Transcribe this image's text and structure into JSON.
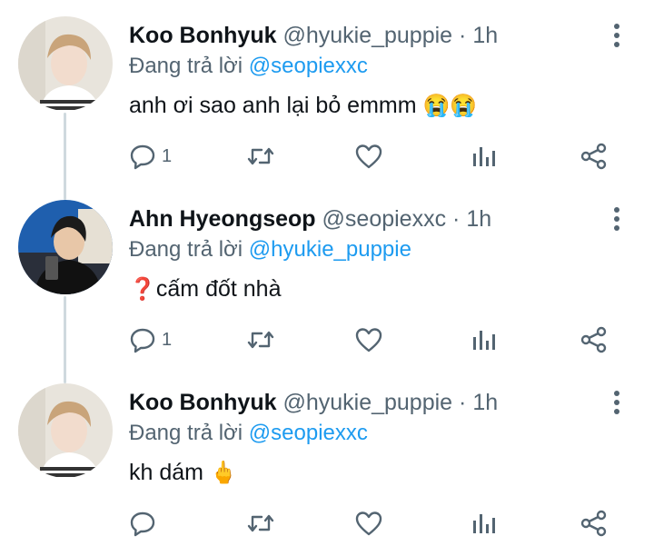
{
  "tweets": [
    {
      "name": "Koo Bonhyuk",
      "handle": "@hyukie_puppie",
      "sep": "·",
      "time": "1h",
      "reply_prefix": "Đang trả lời",
      "reply_to": "@seopiexxc",
      "text": "anh ơi sao anh lại bỏ emmm",
      "emoji": "😭😭",
      "reply_count": "1",
      "avatar": "avatar-koo-bonhyuk"
    },
    {
      "name": "Ahn Hyeongseop",
      "handle": "@seopiexxc",
      "sep": "·",
      "time": "1h",
      "reply_prefix": "Đang trả lời",
      "reply_to": "@hyukie_puppie",
      "emoji_prefix": "❓",
      "text": "cấm đốt nhà",
      "reply_count": "1",
      "avatar": "avatar-ahn-hyeongseop"
    },
    {
      "name": "Koo Bonhyuk",
      "handle": "@hyukie_puppie",
      "sep": "·",
      "time": "1h",
      "reply_prefix": "Đang trả lời",
      "reply_to": "@seopiexxc",
      "text": "kh dám",
      "emoji": "🖕",
      "reply_count": "",
      "avatar": "avatar-koo-bonhyuk"
    }
  ],
  "icons": {
    "reply": "reply-icon",
    "retweet": "retweet-icon",
    "like": "heart-icon",
    "views": "analytics-icon",
    "share": "share-icon",
    "more": "more-vertical-icon"
  },
  "colors": {
    "mention": "#1d9bf0",
    "secondary_text": "#536471",
    "thread_line": "#cfd9de"
  }
}
